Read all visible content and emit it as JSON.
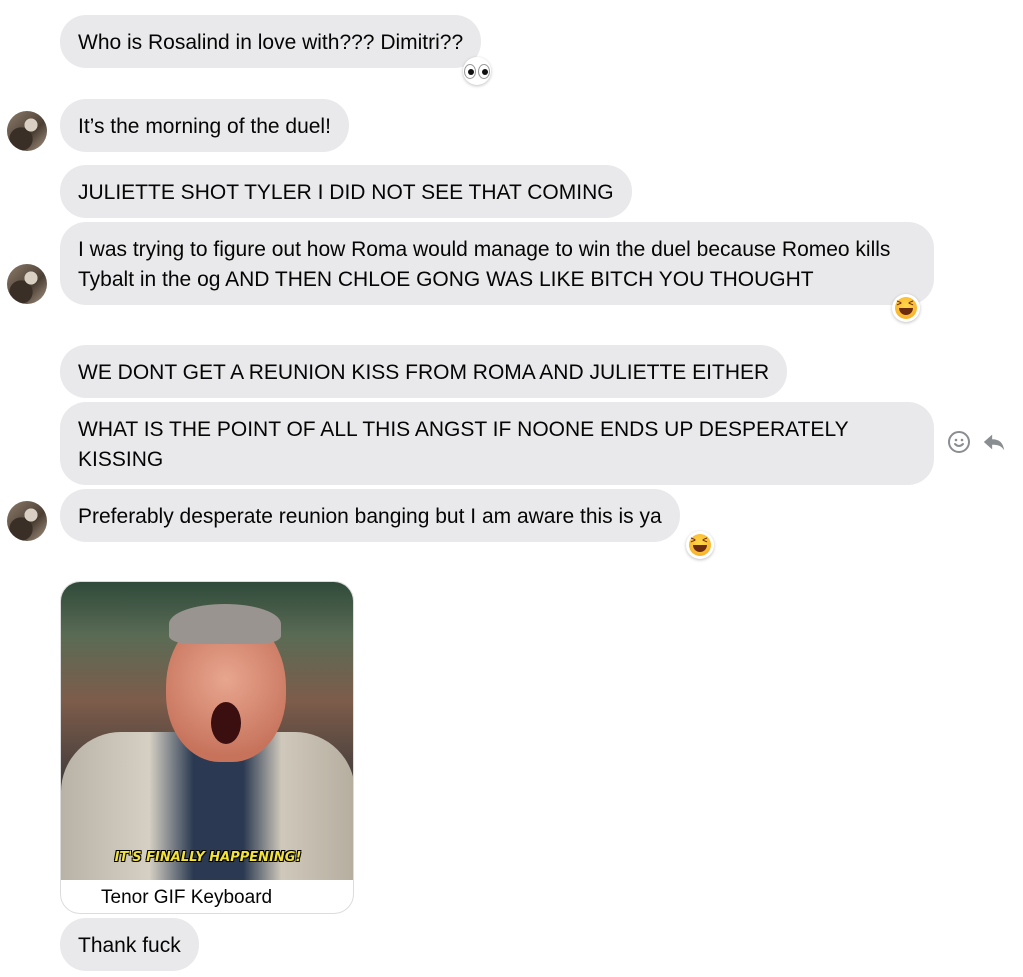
{
  "messages": [
    {
      "text": "Who is Rosalind in love with??? Dimitri??",
      "reaction": "eyes-emoji"
    },
    {
      "text": "It’s the morning of the duel!"
    },
    {
      "text": "JULIETTE SHOT TYLER I DID NOT SEE THAT COMING"
    },
    {
      "text": "I was trying to figure out how Roma would manage to win the duel because Romeo kills Tybalt in the og AND THEN CHLOE GONG WAS LIKE BITCH YOU THOUGHT",
      "reaction": "laughing-emoji"
    },
    {
      "text": "WE DONT GET A REUNION KISS FROM ROMA AND JULIETTE EITHER"
    },
    {
      "text": "WHAT IS THE POINT OF ALL THIS ANGST IF NOONE ENDS UP DESPERATELY KISSING"
    },
    {
      "text": "Preferably desperate reunion banging but I am aware this is ya",
      "reaction": "laughing-emoji"
    },
    {
      "text": "Thank fuck"
    }
  ],
  "gif": {
    "caption": "IT'S FINALLY HAPPENING!",
    "source": "Tenor GIF Keyboard"
  },
  "icons": {
    "react": "smiley-icon",
    "reply": "reply-icon"
  }
}
